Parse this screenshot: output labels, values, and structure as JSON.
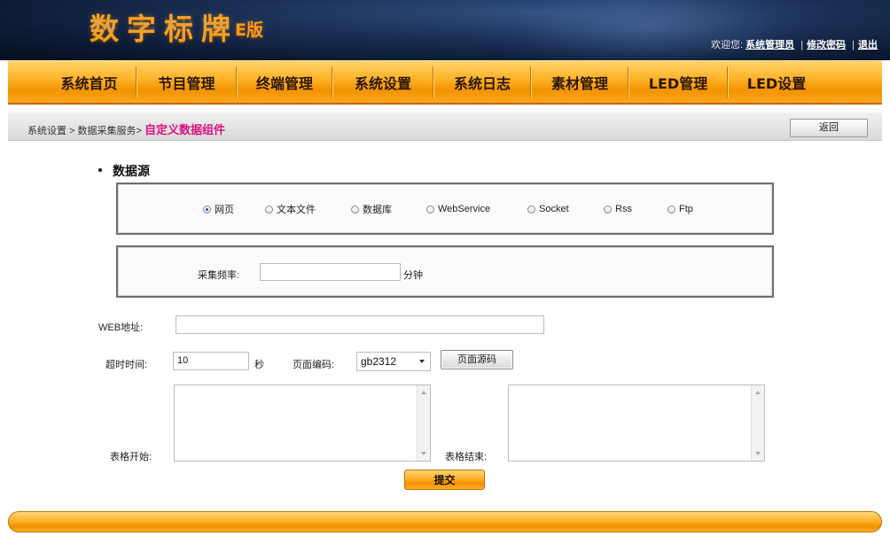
{
  "header": {
    "logo_main": "数字标牌",
    "logo_sub": "E版",
    "welcome_text": "欢迎您:",
    "user_link": "系统管理员",
    "change_password_link": "修改密码",
    "logout_link": "退出",
    "separator": "|"
  },
  "nav": {
    "items": [
      {
        "label": "系统首页"
      },
      {
        "label": "节目管理"
      },
      {
        "label": "终端管理"
      },
      {
        "label": "系统设置"
      },
      {
        "label": "系统日志"
      },
      {
        "label": "素材管理"
      },
      {
        "label": "LED管理"
      },
      {
        "label": "LED设置"
      }
    ]
  },
  "breadcrumb": {
    "part1": "系统设置",
    "sep1": " > ",
    "part2": "数据采集服务",
    "sep2": "> ",
    "current": "自定义数据组件",
    "back_label": "返回"
  },
  "datasource": {
    "title": "数据源",
    "options": [
      {
        "label": "网页",
        "checked": true
      },
      {
        "label": "文本文件",
        "checked": false
      },
      {
        "label": "数据库",
        "checked": false
      },
      {
        "label": "WebService",
        "checked": false
      },
      {
        "label": "Socket",
        "checked": false
      },
      {
        "label": "Rss",
        "checked": false
      },
      {
        "label": "Ftp",
        "checked": false
      }
    ]
  },
  "frequency": {
    "label": "采集频率:",
    "value": "",
    "unit": "分钟"
  },
  "form": {
    "web_address_label": "WEB地址:",
    "web_address_value": "",
    "timeout_label": "超时时间:",
    "timeout_value": "10",
    "timeout_unit": "秒",
    "encoding_label": "页面编码:",
    "encoding_value": "gb2312",
    "page_source_button": "页面源码",
    "table_start_label": "表格开始:",
    "table_end_label": "表格结束:",
    "submit_label": "提交"
  }
}
